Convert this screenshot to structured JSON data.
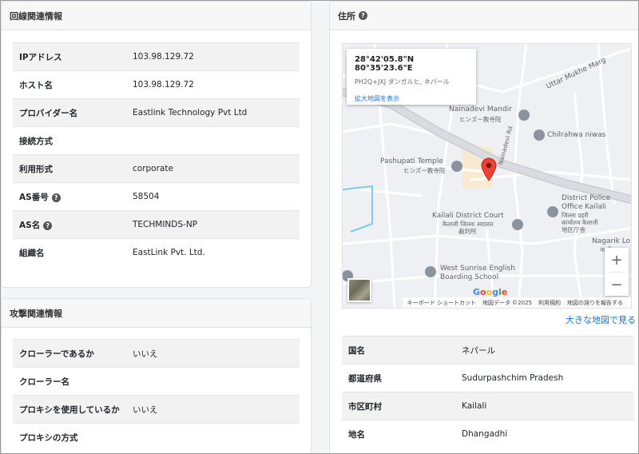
{
  "line_info": {
    "header": "回線関連情報",
    "rows": [
      {
        "label": "IPアドレス",
        "value": "103.98.129.72",
        "help": false
      },
      {
        "label": "ホスト名",
        "value": "103.98.129.72",
        "help": false
      },
      {
        "label": "プロバイダー名",
        "value": "Eastlink Technology Pvt Ltd",
        "help": false
      },
      {
        "label": "接続方式",
        "value": "",
        "help": false
      },
      {
        "label": "利用形式",
        "value": "corporate",
        "help": false
      },
      {
        "label": "AS番号",
        "value": "58504",
        "help": true
      },
      {
        "label": "AS名",
        "value": "TECHMINDS-NP",
        "help": true
      },
      {
        "label": "組織名",
        "value": "EastLink Pvt. Ltd.",
        "help": false
      }
    ]
  },
  "attack_info": {
    "header": "攻撃関連情報",
    "rows": [
      {
        "label": "クローラーであるか",
        "value": "いいえ"
      },
      {
        "label": "クローラー名",
        "value": ""
      },
      {
        "label": "プロキシを使用しているか",
        "value": "いいえ"
      },
      {
        "label": "プロキシの方式",
        "value": ""
      }
    ]
  },
  "address": {
    "header": "住所",
    "help_glyph": "?",
    "big_map_link": "大きな地図で見る",
    "rows": [
      {
        "label": "国名",
        "value": "ネパール"
      },
      {
        "label": "都道府県",
        "value": "Sudurpashchim Pradesh"
      },
      {
        "label": "市区町村",
        "value": "Kailali"
      },
      {
        "label": "地名",
        "value": "Dhangadhi"
      }
    ]
  },
  "map": {
    "info_window": {
      "coords": "28°42'05.8\"N 80°35'23.6\"E",
      "plus_code": "PH2Q+JXJ ダンガルヒ, ネパール",
      "enlarge_link": "拡大地図を表示"
    },
    "labels": {
      "uttar_mukhe": "Uttar Mukhe Marg",
      "nainadevi_mandir": "Nainadevi Mandir",
      "nainadevi_mandir_jp": "ヒンズー教寺院",
      "chilrahwa": "Chilrahwa niwas",
      "nainadevi_rd": "Nainadevi Rd",
      "pashupati": "Pashupati Temple",
      "pashupati_jp": "ヒンズー教寺院",
      "district_police_1": "District Police",
      "district_police_2": "Office Kailali",
      "district_police_np1": "जिल्ला प्रहरी",
      "district_police_np2": "कार्यालय कैलाली",
      "district_police_jp": "地区庁舎",
      "court": "Kailali District Court",
      "court_np": "कैलाली जिल्ला अदालत",
      "court_jp": "裁判所",
      "nagarik": "Nagarik Lo",
      "nagarik_np": "नागरिक",
      "school_1": "West Sunrise English",
      "school_2": "Boarding School"
    },
    "zoom_in": "+",
    "zoom_out": "−",
    "google": [
      "G",
      "o",
      "o",
      "g",
      "l",
      "e"
    ],
    "google_colors": [
      "#4285F4",
      "#EA4335",
      "#FBBC05",
      "#4285F4",
      "#34A853",
      "#EA4335"
    ],
    "footer": [
      "キーボード ショートカット",
      "地図データ ©2025",
      "利用規約",
      "地図の誤りを報告する"
    ],
    "marker_color": "#ea4335"
  }
}
